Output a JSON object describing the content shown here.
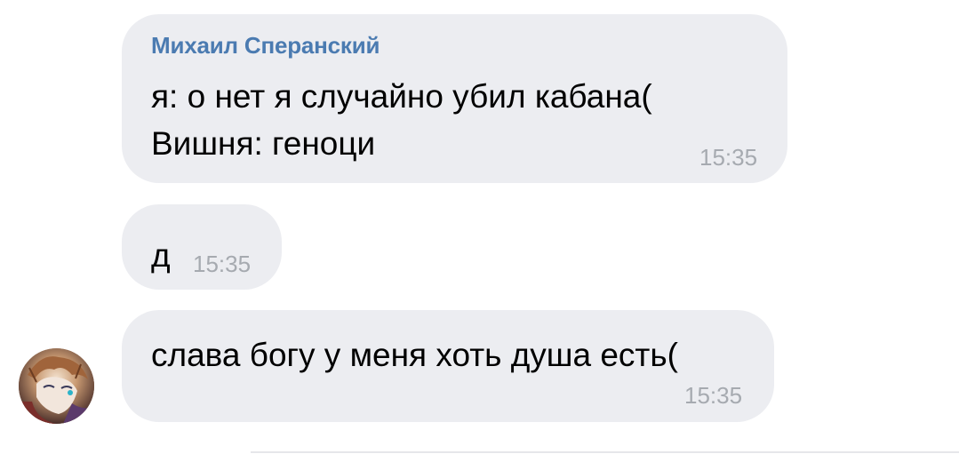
{
  "messages": [
    {
      "sender": "Михаил Сперанский",
      "lines": [
        "я: о нет я случайно убил кабана(",
        "Вишня: геноци"
      ],
      "time": "15:35"
    },
    {
      "lines": [
        "д"
      ],
      "time": "15:35"
    },
    {
      "lines": [
        "слава богу у меня хоть душа есть("
      ],
      "time": "15:35"
    }
  ],
  "colors": {
    "bubble_bg": "#ecedf1",
    "sender_name": "#4b7bb1",
    "timestamp": "#a6aab0",
    "text": "#000000"
  },
  "icons": {
    "avatar": "user-avatar"
  }
}
